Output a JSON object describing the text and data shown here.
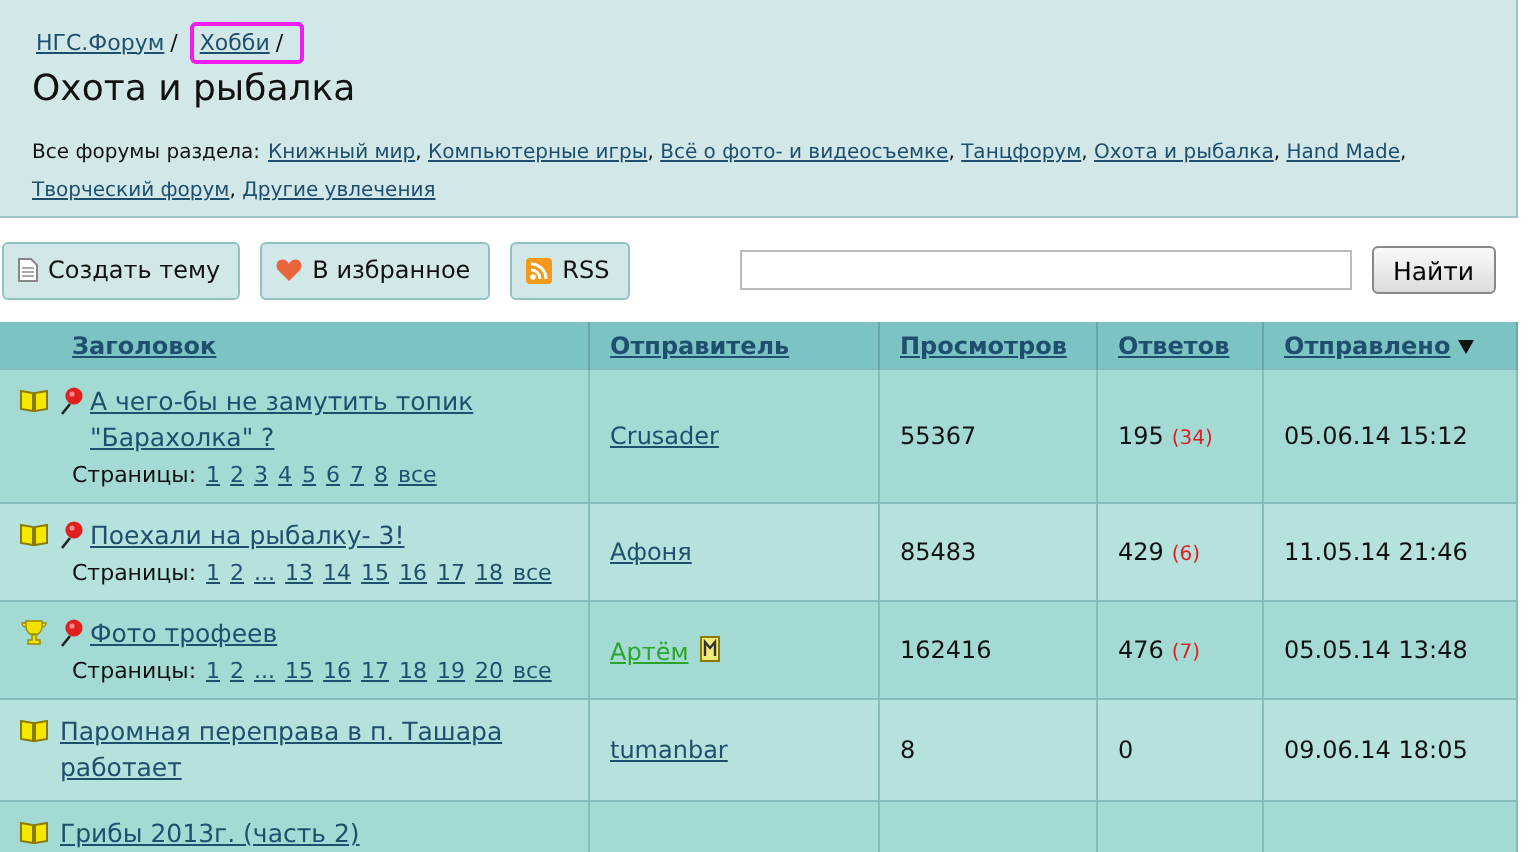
{
  "breadcrumbs": [
    {
      "label": "НГС.Форум",
      "sep": "/",
      "highlighted": false
    },
    {
      "label": "Хобби",
      "sep": "/",
      "highlighted": true
    }
  ],
  "title": "Охота и рыбалка",
  "forums": {
    "label": "Все форумы раздела:",
    "links": [
      {
        "label": "Книжный мир",
        "after": ","
      },
      {
        "label": "Компьютерные игры",
        "after": ","
      },
      {
        "label": "Всё о фото- и видеосъемке",
        "after": ","
      },
      {
        "label": "Танцфорум",
        "after": ","
      },
      {
        "label": "Охота и рыбалка",
        "after": ","
      },
      {
        "label": "Hand Made",
        "after": ","
      },
      {
        "label": "Творческий форум",
        "after": ","
      },
      {
        "label": "Другие увлечения"
      }
    ]
  },
  "actions": [
    {
      "label": "Создать тему",
      "kind": "page"
    },
    {
      "label": "В избранное",
      "kind": "heart"
    },
    {
      "label": "RSS",
      "kind": "rss"
    }
  ],
  "search": {
    "button": "Найти"
  },
  "table": {
    "columns": [
      {
        "label": "Заголовок",
        "sorted": false
      },
      {
        "label": "Отправитель",
        "sorted": false
      },
      {
        "label": "Просмотров",
        "sorted": false
      },
      {
        "label": "Ответов",
        "sorted": false
      },
      {
        "label": "Отправлено",
        "sorted": true
      }
    ],
    "rows": [
      {
        "kind": "book",
        "pinned": true,
        "title": "А чего-бы не замутить топик \"Барахолка\" ?",
        "pages_label": "Страницы:",
        "pages": [
          "1",
          "2",
          "3",
          "4",
          "5",
          "6",
          "7",
          "8",
          "все"
        ],
        "sender": "Crusader",
        "moderator": false,
        "views": "55367",
        "replies": "195",
        "new": "(34)",
        "date": "05.06.14 15:12"
      },
      {
        "kind": "book",
        "pinned": true,
        "title": "Поехали на рыбалку- 3!",
        "pages_label": "Страницы:",
        "pages": [
          "1",
          "2",
          "...",
          "13",
          "14",
          "15",
          "16",
          "17",
          "18",
          "все"
        ],
        "sender": "Афоня",
        "moderator": false,
        "views": "85483",
        "replies": "429",
        "new": "(6)",
        "date": "11.05.14 21:46"
      },
      {
        "kind": "trophy",
        "pinned": true,
        "title": "Фото трофеев",
        "pages_label": "Страницы:",
        "pages": [
          "1",
          "2",
          "...",
          "15",
          "16",
          "17",
          "18",
          "19",
          "20",
          "все"
        ],
        "sender": "Артём",
        "moderator": true,
        "views": "162416",
        "replies": "476",
        "new": "(7)",
        "date": "05.05.14 13:48"
      },
      {
        "kind": "book",
        "pinned": false,
        "title": "Паромная переправа в п. Ташара работает",
        "sender": "tumanbar",
        "moderator": false,
        "views": "8",
        "replies": "0",
        "date": "09.06.14 18:05"
      },
      {
        "kind": "book",
        "pinned": false,
        "title": "Грибы 2013г. (часть 2)"
      }
    ]
  }
}
